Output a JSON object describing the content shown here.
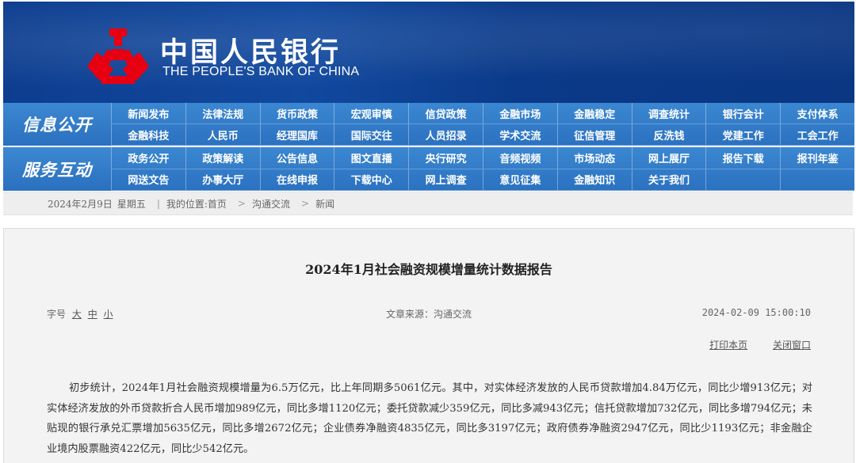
{
  "header": {
    "bank_name_cn": "中国人民银行",
    "bank_name_en": "THE PEOPLE'S BANK OF CHINA"
  },
  "nav": {
    "sections": [
      {
        "title": "信息公开",
        "items": [
          "新闻发布",
          "法律法规",
          "货币政策",
          "宏观审慎",
          "信贷政策",
          "金融市场",
          "金融稳定",
          "调查统计",
          "银行会计",
          "支付体系",
          "金融科技",
          "人民币",
          "经理国库",
          "国际交往",
          "人员招录",
          "学术交流",
          "征信管理",
          "反洗钱",
          "党建工作",
          "工会工作"
        ]
      },
      {
        "title": "服务互动",
        "items": [
          "政务公开",
          "政策解读",
          "公告信息",
          "图文直播",
          "央行研究",
          "音频视频",
          "市场动态",
          "网上展厅",
          "报告下载",
          "报刊年鉴",
          "网送文告",
          "办事大厅",
          "在线申报",
          "下载中心",
          "网上调查",
          "意见征集",
          "金融知识",
          "关于我们",
          "",
          ""
        ]
      }
    ]
  },
  "breadcrumb": {
    "date": "2024年2月9日",
    "weekday": "星期五",
    "location_label": "我的位置:首页",
    "level2": "沟通交流",
    "level3": "新闻"
  },
  "article": {
    "title": "2024年1月社会融资规模增量统计数据报告",
    "font_size_label": "字号",
    "font_large": "大",
    "font_medium": "中",
    "font_small": "小",
    "source": "文章来源：沟通交流",
    "datetime": "2024-02-09 15:00:10",
    "print_label": "打印本页",
    "close_label": "关闭窗口",
    "body": "初步统计，2024年1月社会融资规模增量为6.5万亿元，比上年同期多5061亿元。其中，对实体经济发放的人民币贷款增加4.84万亿元，同比少增913亿元；对实体经济发放的外币贷款折合人民币增加989亿元，同比多增1120亿元；委托贷款减少359亿元，同比多减943亿元；信托贷款增加732亿元，同比多增794亿元；未贴现的银行承兑汇票增加5635亿元，同比多增2672亿元；企业债券净融资4835亿元，同比多3197亿元；政府债券净融资2947亿元，同比少1193亿元；非金融企业境内股票融资422亿元，同比少542亿元。"
  },
  "colors": {
    "banner": "#0d3d8f",
    "nav": "#2f78c6",
    "emblem": "#e60012"
  }
}
